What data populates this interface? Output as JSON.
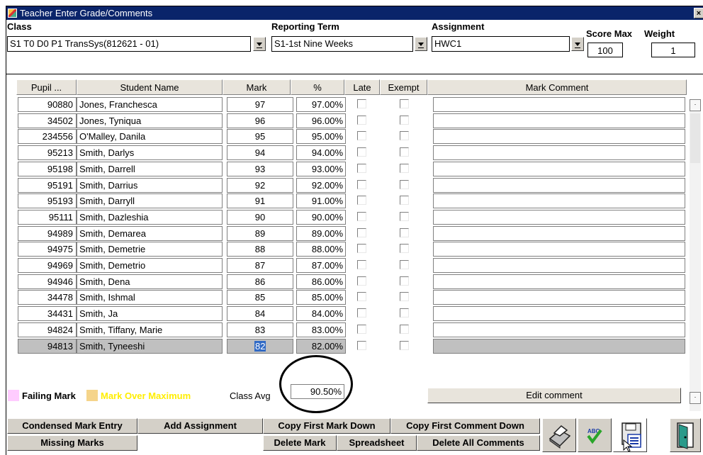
{
  "window": {
    "title": "Teacher Enter Grade/Comments",
    "close_glyph": "×"
  },
  "filters": {
    "class_label": "Class",
    "class_value": "S1 T0 D0 P1 TransSys(812621 - 01)",
    "term_label": "Reporting Term",
    "term_value": "S1-1st Nine Weeks",
    "assignment_label": "Assignment",
    "assignment_value": "HWC1",
    "score_max_label": "Score Max",
    "score_max_value": "100",
    "weight_label": "Weight",
    "weight_value": "1"
  },
  "table": {
    "headers": {
      "pupil": "Pupil ...",
      "name": "Student Name",
      "mark": "Mark",
      "pct": "%",
      "late": "Late",
      "exempt": "Exempt",
      "comment": "Mark Comment"
    },
    "rows": [
      {
        "pupil": "90880",
        "name": "Jones, Franchesca",
        "mark": "97",
        "pct": "97.00%"
      },
      {
        "pupil": "34502",
        "name": "Jones, Tyniqua",
        "mark": "96",
        "pct": "96.00%"
      },
      {
        "pupil": "234556",
        "name": "O'Malley, Danila",
        "mark": "95",
        "pct": "95.00%"
      },
      {
        "pupil": "95213",
        "name": "Smith, Darlys",
        "mark": "94",
        "pct": "94.00%"
      },
      {
        "pupil": "95198",
        "name": "Smith, Darrell",
        "mark": "93",
        "pct": "93.00%"
      },
      {
        "pupil": "95191",
        "name": "Smith, Darrius",
        "mark": "92",
        "pct": "92.00%"
      },
      {
        "pupil": "95193",
        "name": "Smith, Darryll",
        "mark": "91",
        "pct": "91.00%"
      },
      {
        "pupil": "95111",
        "name": "Smith, Dazleshia",
        "mark": "90",
        "pct": "90.00%"
      },
      {
        "pupil": "94989",
        "name": "Smith, Demarea",
        "mark": "89",
        "pct": "89.00%"
      },
      {
        "pupil": "94975",
        "name": "Smith, Demetrie",
        "mark": "88",
        "pct": "88.00%"
      },
      {
        "pupil": "94969",
        "name": "Smith, Demetrio",
        "mark": "87",
        "pct": "87.00%"
      },
      {
        "pupil": "94946",
        "name": "Smith, Dena",
        "mark": "86",
        "pct": "86.00%"
      },
      {
        "pupil": "34478",
        "name": "Smith, Ishmal",
        "mark": "85",
        "pct": "85.00%"
      },
      {
        "pupil": "34431",
        "name": "Smith, Ja",
        "mark": "84",
        "pct": "84.00%"
      },
      {
        "pupil": "94824",
        "name": "Smith, Tiffany, Marie",
        "mark": "83",
        "pct": "83.00%"
      },
      {
        "pupil": "94813",
        "name": "Smith, Tyneeshi",
        "mark": "82",
        "pct": "82.00%"
      }
    ]
  },
  "legend": {
    "failing_label": "Failing Mark",
    "failing_color": "#ffccff",
    "over_max_label": "Mark Over Maximum",
    "over_max_color": "#f5d48a",
    "over_max_text_color": "#ffee00",
    "class_avg_label": "Class Avg",
    "class_avg_value": "90.50%",
    "edit_comment_label": "Edit comment"
  },
  "buttons": {
    "condensed": "Condensed Mark Entry",
    "add_assignment": "Add Assignment",
    "copy_mark": "Copy First Mark Down",
    "copy_comment": "Copy First Comment Down",
    "missing": "Missing Marks",
    "delete_mark": "Delete Mark",
    "spreadsheet": "Spreadsheet",
    "delete_comments": "Delete All Comments"
  },
  "icons": [
    "printer-icon",
    "spellcheck-icon",
    "save-icon",
    "exit-door-icon"
  ]
}
